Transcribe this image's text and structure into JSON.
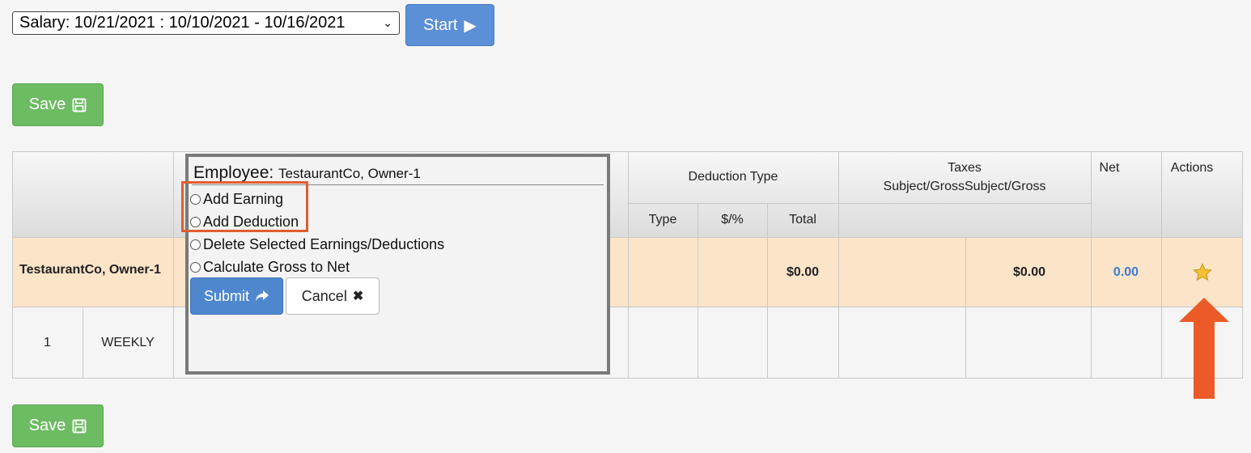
{
  "toolbar": {
    "period_select_value": "Salary: 10/21/2021 : 10/10/2021 - 10/16/2021",
    "start_label": "Start",
    "save_label": "Save"
  },
  "table": {
    "headers": {
      "deduction_type": "Deduction Type",
      "taxes_line1": "Taxes",
      "taxes_line2": "Subject/GrossSubject/Gross",
      "net": "Net",
      "actions": "Actions",
      "type": "Type",
      "dollar_pct": "$/%",
      "total": "Total"
    },
    "employee_row": {
      "name": "TestaurantCo, Owner-1",
      "deduction_total": "$0.00",
      "taxes_total": "$0.00",
      "net": "0.00"
    },
    "detail_row": {
      "num": "1",
      "frequency": "WEEKLY"
    }
  },
  "popup": {
    "title_label": "Employee:",
    "title_value": "TestaurantCo, Owner-1",
    "options": [
      "Add Earning",
      "Add Deduction",
      "Delete Selected Earnings/Deductions",
      "Calculate Gross to Net"
    ],
    "submit_label": "Submit",
    "cancel_label": "Cancel"
  },
  "colors": {
    "primary": "#5b8fd6",
    "success": "#6dbb63",
    "row_highlight": "#fbe4c8",
    "annotation": "#e05d30",
    "star": "#f3c132"
  }
}
